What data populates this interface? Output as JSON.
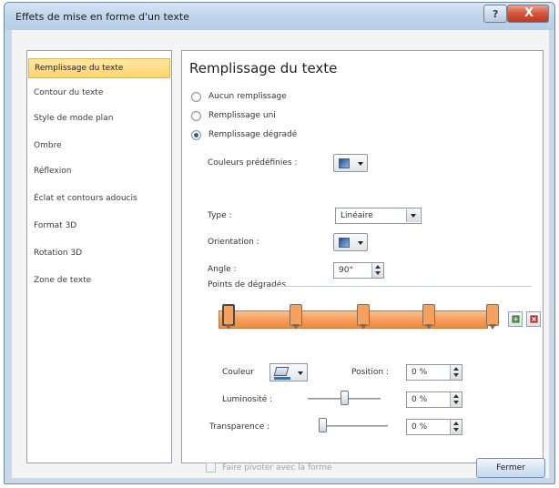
{
  "window": {
    "title": "Effets de mise en forme d'un texte",
    "help_icon": "?",
    "close_icon": "X"
  },
  "nav": {
    "items": [
      {
        "label": "Remplissage du texte",
        "active": true
      },
      {
        "label": "Contour du texte",
        "active": false
      },
      {
        "label": "Style de mode plan",
        "active": false
      },
      {
        "label": "Ombre",
        "active": false
      },
      {
        "label": "Réflexion",
        "active": false
      },
      {
        "label": "Éclat et contours adoucis",
        "active": false
      },
      {
        "label": "Format 3D",
        "active": false
      },
      {
        "label": "Rotation 3D",
        "active": false
      },
      {
        "label": "Zone de texte",
        "active": false
      }
    ]
  },
  "panel": {
    "heading": "Remplissage du texte",
    "fill_options": [
      {
        "label": "Aucun remplissage",
        "selected": false
      },
      {
        "label": "Remplissage uni",
        "selected": false
      },
      {
        "label": "Remplissage dégradé",
        "selected": true
      }
    ],
    "preset_colors_label": "Couleurs prédéfinies :",
    "type_label": "Type :",
    "type_value": "Linéaire",
    "orientation_label": "Orientation :",
    "angle_label": "Angle :",
    "angle_value": "90°",
    "gradient_stops_title": "Points de dégradés",
    "gradient_color": "#f5a160",
    "gradient_stop_count": 5,
    "color_label": "Couleur",
    "position_label": "Position :",
    "position_value": "0 %",
    "brightness_label": "Luminosité :",
    "brightness_value": "0 %",
    "brightness_level": 0,
    "transparency_label": "Transparence :",
    "transparency_value": "0 %",
    "transparency_level": 0,
    "rotate_checkbox_label": "Faire pivoter avec la forme"
  },
  "footer": {
    "close_label": "Fermer"
  },
  "colors": {
    "accent_orange": "#f5a160",
    "selection_yellow": "#ffd36a",
    "window_frame": "#c9d9ea"
  }
}
